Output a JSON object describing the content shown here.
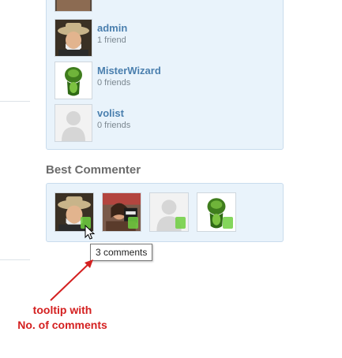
{
  "friends": [
    {
      "name": "",
      "count": "",
      "avatar": "photo-avatar"
    },
    {
      "name": "admin",
      "count": "1 friend",
      "avatar": "man-with-hat-avatar"
    },
    {
      "name": "MisterWizard",
      "count": "0 friends",
      "avatar": "green-snake-avatar"
    },
    {
      "name": "volist",
      "count": "0 friends",
      "avatar": "default-person-avatar"
    }
  ],
  "best_commenter": {
    "title": "Best Commenter",
    "commenters": [
      {
        "avatar": "man-with-hat-avatar"
      },
      {
        "avatar": "woman-photo-avatar"
      },
      {
        "avatar": "default-person-avatar"
      },
      {
        "avatar": "green-snake-avatar"
      }
    ]
  },
  "tooltip": {
    "text": "3 comments"
  },
  "annotation": {
    "line1": "tooltip with",
    "line2": "No. of comments"
  },
  "colors": {
    "panel_bg": "#e9f3fb",
    "panel_border": "#c9dced",
    "name_link": "#4a7fae",
    "annotation_red": "#d42020"
  }
}
